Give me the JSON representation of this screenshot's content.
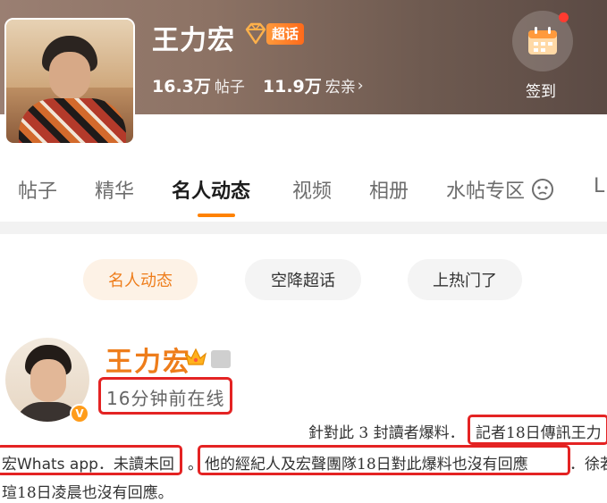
{
  "header": {
    "name": "王力宏",
    "badge_label": "超话",
    "posts_count": "16.3万",
    "posts_label": "帖子",
    "fans_count": "11.9万",
    "fans_label": "宏亲",
    "checkin_label": "签到",
    "colors": {
      "badge": "#ff7a1e",
      "notification_dot": "#ff3b30"
    }
  },
  "tabs": [
    {
      "label": "帖子"
    },
    {
      "label": "精华"
    },
    {
      "label": "名人动态",
      "active": true
    },
    {
      "label": "视频"
    },
    {
      "label": "相册"
    },
    {
      "label": "水帖专区"
    },
    {
      "label": "L"
    }
  ],
  "chips": [
    {
      "label": "名人动态",
      "active": true
    },
    {
      "label": "空降超话"
    },
    {
      "label": "上热门了"
    }
  ],
  "post": {
    "author": "王力宏",
    "online_status": "16分钟前在线",
    "accent": "#ee7d1b"
  },
  "news_text": {
    "line1_prefix": "針對此 3 封讀者爆料．",
    "line1_highlight": "記者18日傳訊王力",
    "line2_highlight_a": "宏Whats app．未讀未回",
    "line2_dot": "。",
    "line2_highlight_b": "他的經紀人及宏聲團隊18日對此爆料也沒有回應",
    "line2_suffix": "．徐若",
    "line3": "瑄18日凌晨也沒有回應。",
    "highlight_color": "#e42323"
  }
}
